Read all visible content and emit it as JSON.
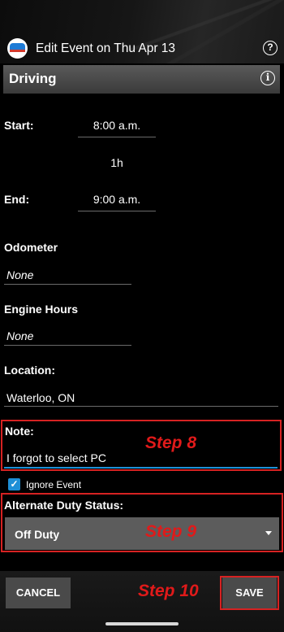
{
  "app_bar": {
    "title": "Edit Event on Thu Apr 13",
    "help_icon": "?"
  },
  "category": {
    "title": "Driving",
    "info_icon": "i"
  },
  "times": {
    "start_label": "Start:",
    "start_value": "8:00 a.m.",
    "duration": "1h",
    "end_label": "End:",
    "end_value": "9:00 a.m."
  },
  "odometer": {
    "label": "Odometer",
    "value": "None"
  },
  "engine_hours": {
    "label": "Engine Hours",
    "value": "None"
  },
  "location": {
    "label": "Location:",
    "value": "Waterloo, ON"
  },
  "note": {
    "label": "Note:",
    "value": "I forgot to select PC"
  },
  "ignore_event": {
    "label": "Ignore Event",
    "checked": true
  },
  "alternate_duty": {
    "label": "Alternate Duty Status:",
    "selected": "Off Duty"
  },
  "annotations": {
    "step8": "Step 8",
    "step9": "Step 9",
    "step10": "Step 10"
  },
  "actions": {
    "cancel": "CANCEL",
    "save": "SAVE"
  },
  "colors": {
    "accent": "#1e8fd6",
    "annotation_red": "#d62222",
    "field_bg": "#5c5c5c"
  }
}
